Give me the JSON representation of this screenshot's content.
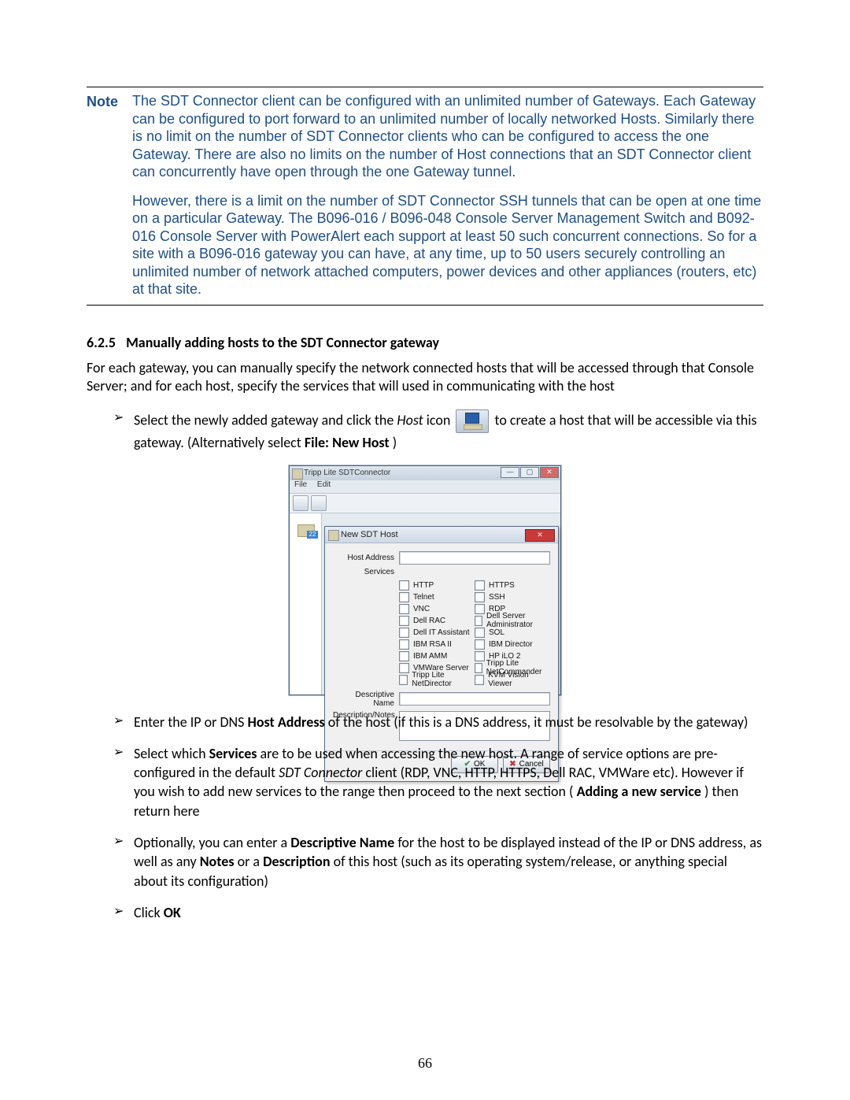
{
  "note": {
    "label": "Note",
    "para1": "The SDT Connector client can be configured with an unlimited number of Gateways. Each Gateway can be configured to port forward to an unlimited number of locally networked Hosts. Similarly there is no limit on the number of SDT Connector clients who can be configured to access the one Gateway. There are also no limits on the number of Host connections that an SDT Connector client can concurrently have open through the one Gateway tunnel.",
    "para2": "However, there is a limit on the number of SDT Connector SSH tunnels that can be open at one time on a particular Gateway. The B096-016 / B096-048 Console Server Management Switch and B092-016 Console Server with PowerAlert each support at least 50 such concurrent connections. So for a site with a B096-016 gateway you can have, at any time, up to 50 users securely controlling an unlimited number of network attached computers, power devices and other appliances (routers, etc) at that site."
  },
  "section": {
    "number": "6.2.5",
    "title": "Manually adding hosts to the SDT Connector gateway"
  },
  "intro": "For each gateway, you can manually specify the network connected hosts that will be accessed through that Console Server; and for each host, specify the services that will used in communicating with the host",
  "bullets": {
    "b1_pre": "Select the newly added gateway and click the ",
    "b1_host": "Host",
    "b1_mid": " icon ",
    "b1_post": " to create a host that will be accessible via this gateway. (Alternatively select ",
    "b1_menu": "File: New Host",
    "b1_end": ")",
    "b2_pre": "Enter the IP or DNS ",
    "b2_bold": "Host Address",
    "b2_post": " of the host (if this is a DNS address, it must be resolvable by the gateway)",
    "b3_pre": "Select which ",
    "b3_bold": "Services",
    "b3_mid": " are to be used when accessing the new host. A range of service options are pre-configured in the default ",
    "b3_it": "SDT Connector",
    "b3_mid2": " client (RDP, VNC, HTTP, HTTPS, Dell RAC, VMWare etc). However if you wish to add new services to the range then proceed to the next section (",
    "b3_bold2": "Adding a new service",
    "b3_end": ") then return here",
    "b4_pre": "Optionally, you can enter a ",
    "b4_bold1": "Descriptive Name",
    "b4_mid1": " for the host to be displayed instead of the IP or DNS address, as well as any ",
    "b4_bold2": "Notes",
    "b4_mid2": " or a ",
    "b4_bold3": "Description",
    "b4_end": " of this host (such as its operating system/release, or anything special about its configuration)",
    "b5_pre": "Click ",
    "b5_bold": "OK"
  },
  "screenshot": {
    "app_title": "Tripp Lite SDTConnector",
    "menu": {
      "file": "File",
      "edit": "Edit"
    },
    "tree_badge": "22",
    "dialog": {
      "title": "New SDT Host",
      "close": "✕",
      "labels": {
        "host_address": "Host Address",
        "services": "Services",
        "descriptive_name": "Descriptive Name",
        "description_notes": "Description/Notes"
      },
      "services_left": [
        "HTTP",
        "Telnet",
        "VNC",
        "Dell RAC",
        "Dell IT Assistant",
        "IBM RSA II",
        "IBM AMM",
        "VMWare Server",
        "Tripp Lite NetDirector"
      ],
      "services_right": [
        "HTTPS",
        "SSH",
        "RDP",
        "Dell Server Administrator",
        "SOL",
        "IBM Director",
        "HP iLO 2",
        "Tripp Lite NetCommander",
        "KVM Vision Viewer"
      ],
      "ok": "OK",
      "cancel": "Cancel"
    },
    "winbtns": {
      "min": "—",
      "max": "▢",
      "close": "✕"
    }
  },
  "page_number": "66"
}
